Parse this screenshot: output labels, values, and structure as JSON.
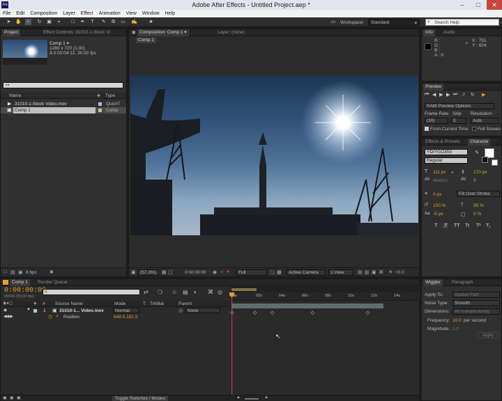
{
  "window": {
    "title": "Adobe After Effects - Untitled Project.aep *",
    "app_icon_text": "Ae",
    "min": "–",
    "max": "□",
    "close": "✕"
  },
  "menu": [
    "File",
    "Edit",
    "Composition",
    "Layer",
    "Effect",
    "Animation",
    "View",
    "Window",
    "Help"
  ],
  "toolbar": {
    "workspace_label": "Workspace:",
    "workspace_value": "Standard",
    "search_placeholder": "Search Help"
  },
  "project": {
    "tab_project": "Project",
    "tab_effect_controls": "Effect Controls: 31010-1-Stock Vi",
    "comp_name": "Comp 1 ▾",
    "comp_size": "1280 x 720 (1.00)",
    "comp_duration": "Δ 0:02:04:12, 30.00 fps",
    "search_icon": "⌕▾",
    "col_name": "Name",
    "col_type": "Type",
    "items": [
      {
        "name": "31010-1-Stock Video.mov",
        "type": "QuickT"
      },
      {
        "name": "Comp 1",
        "type": "Comp"
      }
    ],
    "bpc": "8 bpc"
  },
  "composition": {
    "tab": "Composition: Comp 1",
    "tab_layer": "Layer: (none)",
    "breadcrumb": "Comp 1",
    "zoom": "(57.3%)",
    "timecode": "0:00:00:00",
    "resolution": "Full",
    "camera": "Active Camera",
    "view": "1 View",
    "exposure": "+0.0"
  },
  "info": {
    "tab_info": "Info",
    "tab_audio": "Audio",
    "r": "R :",
    "g": "G :",
    "b": "B :",
    "a": "A : 0",
    "x": "X : 751",
    "y": "Y : 824"
  },
  "preview": {
    "tab": "Preview",
    "ram_options": "RAM Preview Options",
    "frame_rate_label": "Frame Rate",
    "skip_label": "Skip",
    "resolution_label": "Resolution",
    "frame_rate_value": "(30)",
    "skip_value": "0",
    "resolution_value": "Auto",
    "from_current": "From Current Time",
    "full_screen": "Full Screen"
  },
  "character": {
    "tab_effects": "Effects & Presets",
    "tab_character": "Characte",
    "font": "YDIYGO350",
    "style": "Regular",
    "size": "111 px",
    "leading": "170 px",
    "kerning": "Metrics",
    "tracking": "0",
    "stroke_width": "0 px",
    "stroke_type": "Fill Over Stroke",
    "vscale": "100 %",
    "hscale": "95 %",
    "baseline": "-5 px",
    "tsume": "0 %",
    "styles": [
      "T",
      "T",
      "TT",
      "Tt",
      "T¹",
      "T₁"
    ]
  },
  "wiggler": {
    "tab": "Wiggler",
    "tab2": "Paragraph",
    "apply_to_label": "Apply To:",
    "apply_to_value": "Spatial Path",
    "noise_label": "Noise Type:",
    "noise_value": "Smooth",
    "dimensions_label": "Dimensions:",
    "dimensions_value": "All Independently",
    "frequency_label": "Frequency:",
    "frequency_value": "10.0",
    "frequency_unit": "per second",
    "magnitude_label": "Magnitude:",
    "magnitude_value": "1.0",
    "apply_button": "Apply"
  },
  "timeline": {
    "tab_comp": "Comp 1",
    "tab_render": "Render Queue",
    "timecode": "0:00:00:00",
    "fps": "00000 (30.00 fps)",
    "col_num": "#",
    "col_source": "Source Name",
    "col_mode": "Mode",
    "col_t": "T",
    "col_trkmat": "TrkMat",
    "col_parent": "Parent",
    "layer_index": "1",
    "layer_name": "31010-1... Video.mov",
    "layer_mode": "Normal",
    "layer_parent": "None",
    "prop_name": "Position",
    "prop_value": "648.0,182.0",
    "ruler_labels": [
      "0s",
      "02s",
      "04s",
      "06s",
      "08s",
      "10s",
      "12s",
      "14s"
    ],
    "keyframe_times": [
      0,
      2,
      3.5,
      7,
      11.8
    ],
    "switches_toggle": "Toggle Switches / Modes"
  }
}
